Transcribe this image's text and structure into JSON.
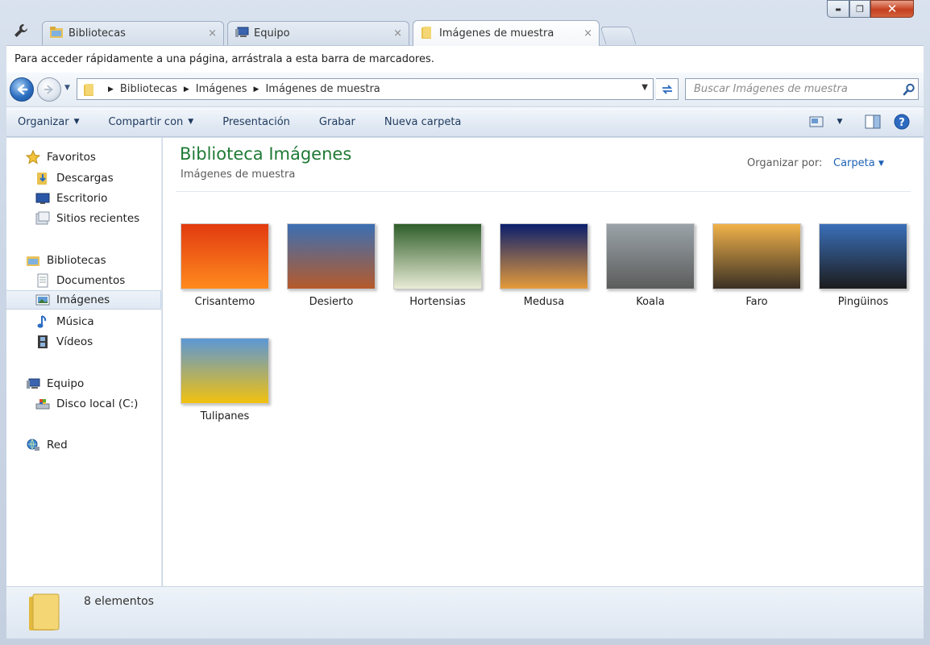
{
  "tabs": [
    {
      "label": "Bibliotecas",
      "close": "×"
    },
    {
      "label": "Equipo",
      "close": "×"
    },
    {
      "label": "Imágenes de muestra",
      "close": "×"
    }
  ],
  "window_controls": {
    "minimize": "▬",
    "maximize": "❐",
    "close": "✕"
  },
  "bookmark_bar": {
    "text": "Para acceder rápidamente a una página, arrástrala a esta barra de marcadores."
  },
  "breadcrumb": [
    "Bibliotecas",
    "Imágenes",
    "Imágenes de muestra"
  ],
  "search": {
    "placeholder": "Buscar Imágenes de muestra"
  },
  "toolbar": {
    "organize": "Organizar",
    "share": "Compartir con",
    "slideshow": "Presentación",
    "burn": "Grabar",
    "new_folder": "Nueva carpeta"
  },
  "sidebar": {
    "favorites": "Favoritos",
    "downloads": "Descargas",
    "desktop": "Escritorio",
    "recent": "Sitios recientes",
    "libraries": "Bibliotecas",
    "documents": "Documentos",
    "images": "Imágenes",
    "music": "Música",
    "videos": "Vídeos",
    "computer": "Equipo",
    "local_disk": "Disco local (C:)",
    "network": "Red"
  },
  "content": {
    "title": "Biblioteca Imágenes",
    "subtitle": "Imágenes de muestra",
    "arrange_label": "Organizar por:",
    "arrange_value": "Carpeta",
    "items": [
      {
        "name": "Crisantemo",
        "color_a": "#e23a10",
        "color_b": "#ff8a1e"
      },
      {
        "name": "Desierto",
        "color_a": "#3b6fb4",
        "color_b": "#b65a2a"
      },
      {
        "name": "Hortensias",
        "color_a": "#2f5e2a",
        "color_b": "#e9ecd5"
      },
      {
        "name": "Medusa",
        "color_a": "#0b1f6e",
        "color_b": "#e59a3a"
      },
      {
        "name": "Koala",
        "color_a": "#9aa3a8",
        "color_b": "#5c5c5c"
      },
      {
        "name": "Faro",
        "color_a": "#f1b24a",
        "color_b": "#3a3024"
      },
      {
        "name": "Pingüinos",
        "color_a": "#3a6fb9",
        "color_b": "#1c1c1c"
      },
      {
        "name": "Tulipanes",
        "color_a": "#5b97d6",
        "color_b": "#f2c10f"
      }
    ]
  },
  "status": {
    "count": "8 elementos"
  }
}
